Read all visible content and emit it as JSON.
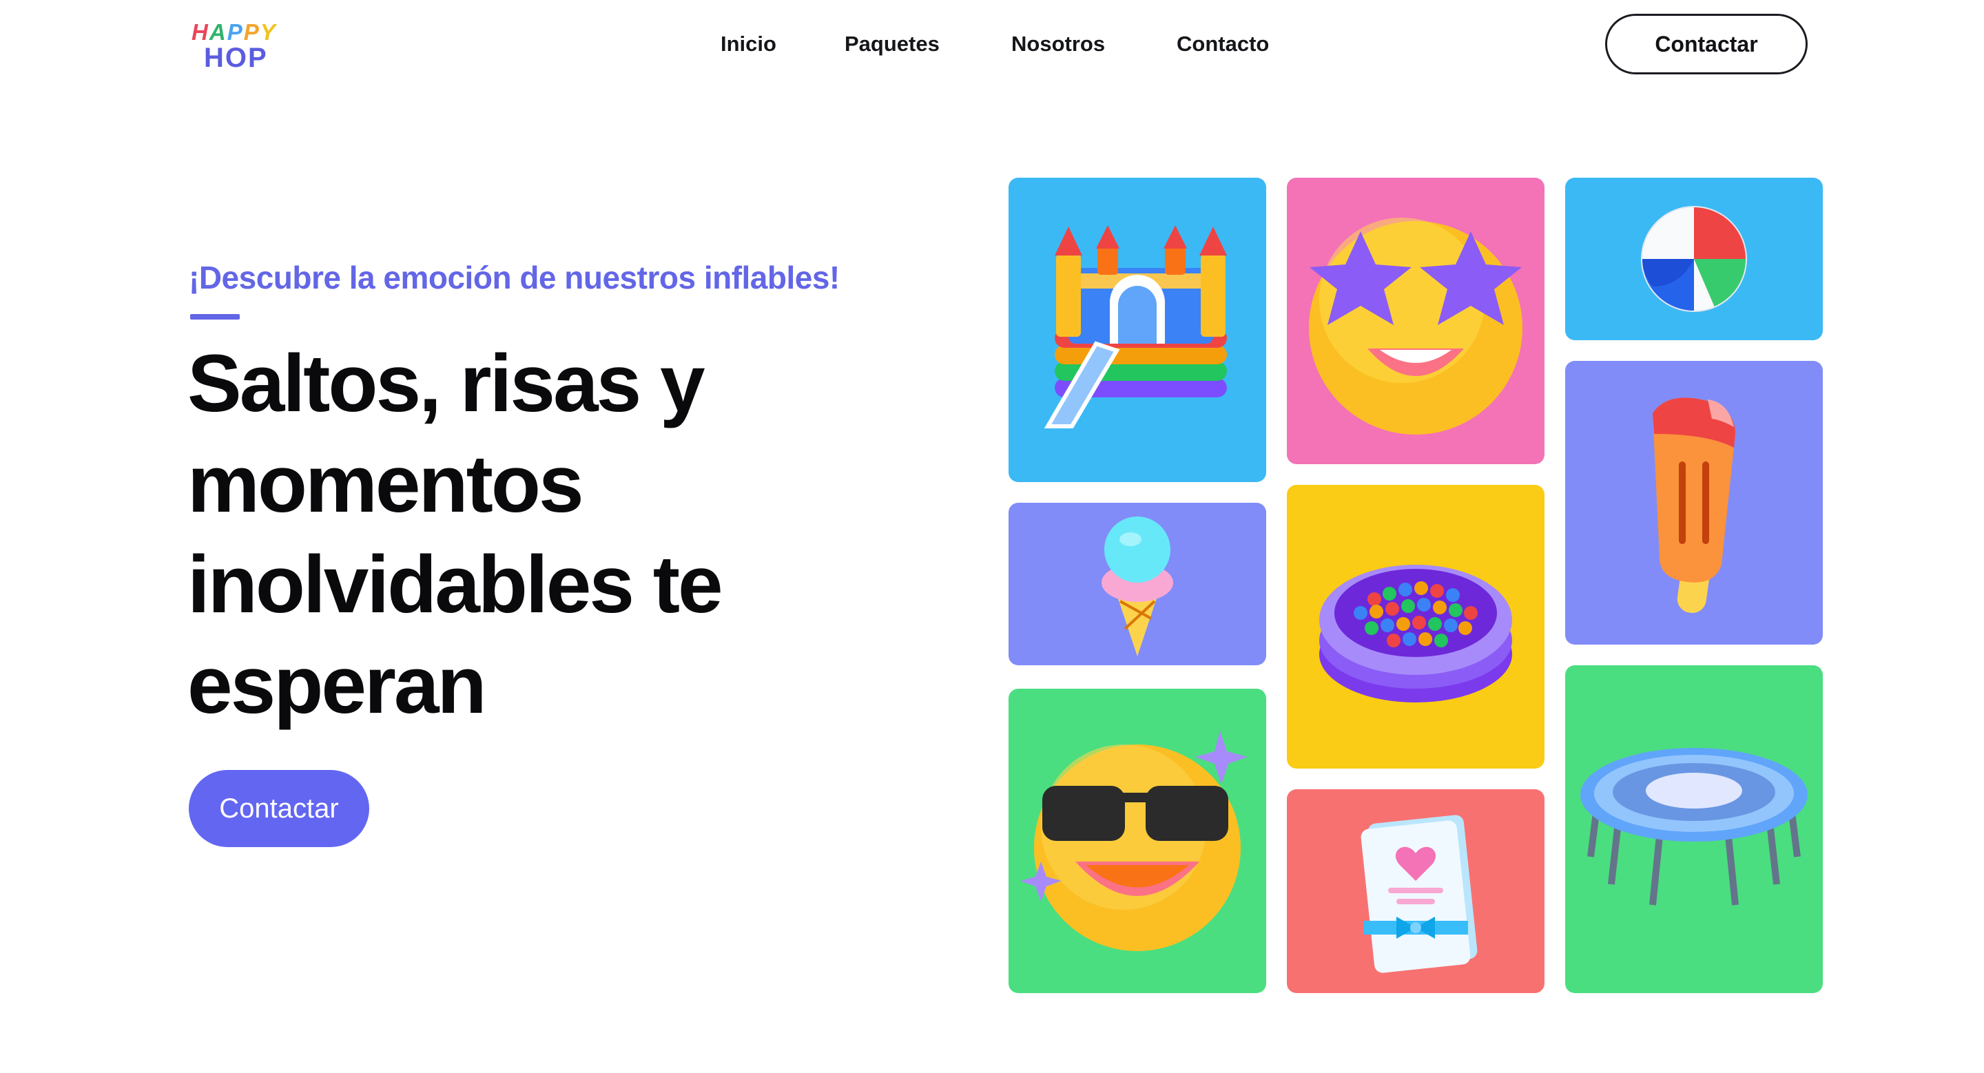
{
  "header": {
    "logo_top_letters": [
      "H",
      "A",
      "P",
      "P",
      "Y"
    ],
    "logo_top_colors": [
      "#e8475b",
      "#2fb36b",
      "#4aa3f0",
      "#f2a52d",
      "#f0c420"
    ],
    "logo_bottom": "HOP",
    "nav": [
      "Inicio",
      "Paquetes",
      "Nosotros",
      "Contacto"
    ],
    "cta_label": "Contactar"
  },
  "hero": {
    "eyebrow": "¡Descubre la emoción de nuestros inflables!",
    "headline_lines": [
      "Saltos, risas y",
      "momentos",
      "inolvidables te",
      "esperan"
    ],
    "cta_label": "Contactar"
  },
  "tiles": [
    {
      "name": "bounce-castle",
      "bg": "#3bb9f5"
    },
    {
      "name": "star-eyes-emoji",
      "bg": "#f472b6"
    },
    {
      "name": "beach-ball",
      "bg": "#3bb9f5"
    },
    {
      "name": "ice-cream-cone",
      "bg": "#818cf8"
    },
    {
      "name": "ball-pit",
      "bg": "#facc15"
    },
    {
      "name": "popsicle",
      "bg": "#818cf8"
    },
    {
      "name": "sunglasses-emoji",
      "bg": "#4ade80"
    },
    {
      "name": "invitation-card",
      "bg": "#f87171"
    },
    {
      "name": "trampoline",
      "bg": "#4ade80"
    }
  ],
  "colors": {
    "accent": "#6366f1",
    "text": "#0a0a0c"
  }
}
